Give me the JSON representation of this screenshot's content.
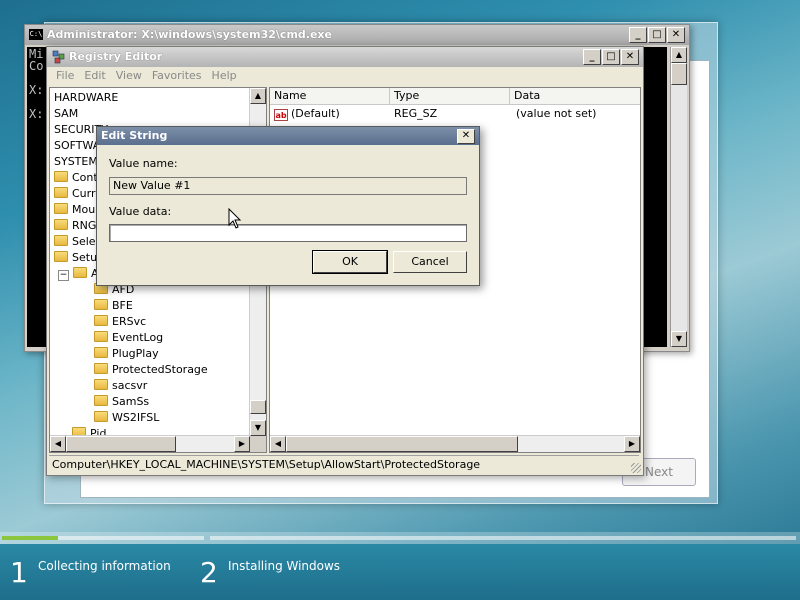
{
  "cmd": {
    "title": "Administrator: X:\\windows\\system32\\cmd.exe",
    "icon_text": "C:\\",
    "lines": [
      "Mi",
      "Co",
      "X:",
      "X:"
    ]
  },
  "registry": {
    "title": "Registry Editor",
    "menu": [
      "File",
      "Edit",
      "View",
      "Favorites",
      "Help"
    ],
    "tree": {
      "roots": [
        "HARDWARE",
        "SAM",
        "SECURITY",
        "SOFTWARE",
        "SYSTEM"
      ],
      "system_children": [
        "Contr",
        "Curre",
        "Moun",
        "RNG",
        "Selec",
        "Setup"
      ],
      "setup_child": "A",
      "allowstart_children": [
        "AFD",
        "BFE",
        "ERSvc",
        "EventLog",
        "PlugPlay",
        "ProtectedStorage",
        "sacsvr",
        "SamSs",
        "WS2IFSL"
      ],
      "last": "Pid"
    },
    "columns": [
      "Name",
      "Type",
      "Data"
    ],
    "rows": [
      {
        "name": "(Default)",
        "type": "REG_SZ",
        "data": "(value not set)"
      }
    ],
    "icon_ab": "ab",
    "status_path": "Computer\\HKEY_LOCAL_MACHINE\\SYSTEM\\Setup\\AllowStart\\ProtectedStorage"
  },
  "dialog": {
    "title": "Edit String",
    "value_name_label": "Value name:",
    "value_name": "New Value #1",
    "value_data_label": "Value data:",
    "value_data": "",
    "ok_label": "OK",
    "cancel_label": "Cancel"
  },
  "setup": {
    "next_label": "Next",
    "steps": [
      {
        "number": "1",
        "label": "Collecting information"
      },
      {
        "number": "2",
        "label": "Installing Windows"
      }
    ],
    "progress_color": "#8cc63f"
  },
  "glyphs": {
    "minimize": "_",
    "maximize": "□",
    "close": "✕",
    "up": "▲",
    "down": "▼",
    "left": "◀",
    "right": "▶",
    "collapse": "−"
  }
}
